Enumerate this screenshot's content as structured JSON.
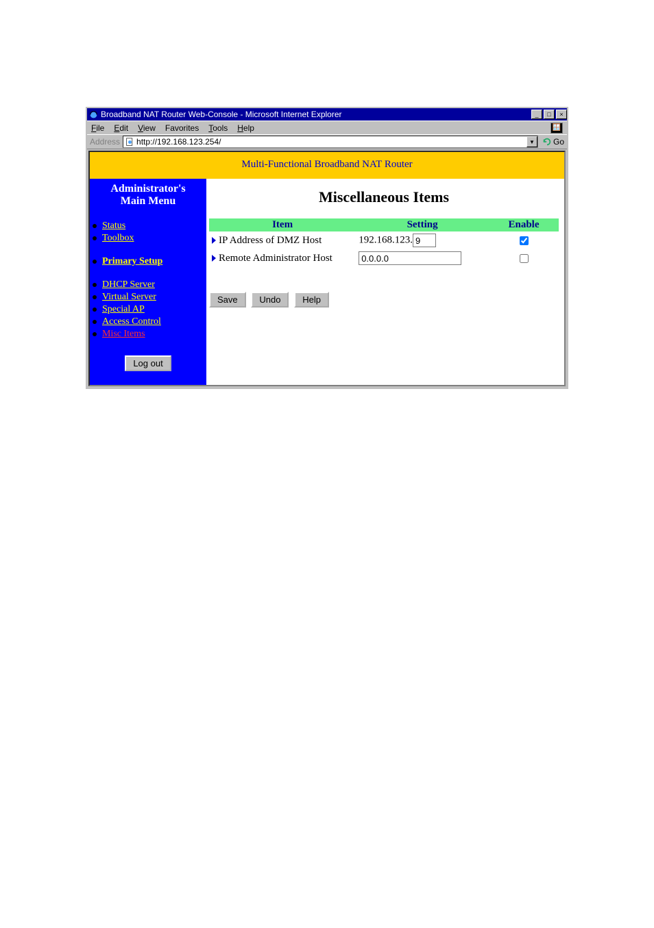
{
  "window": {
    "title": "Broadband NAT Router Web-Console - Microsoft Internet Explorer",
    "minimize": "_",
    "maximize": "□",
    "close": "×"
  },
  "menu": {
    "file": "File",
    "edit": "Edit",
    "view": "View",
    "favorites": "Favorites",
    "tools": "Tools",
    "help": "Help"
  },
  "address": {
    "label": "Address",
    "url": "http://192.168.123.254/",
    "go": "Go"
  },
  "banner": "Multi-Functional Broadband NAT Router",
  "sidebar": {
    "title1": "Administrator's",
    "title2": "Main Menu",
    "group1": [
      {
        "label": "Status"
      },
      {
        "label": "Toolbox"
      }
    ],
    "group2": [
      {
        "label": "Primary Setup"
      }
    ],
    "group3": [
      {
        "label": "DHCP Server"
      },
      {
        "label": "Virtual Server"
      },
      {
        "label": "Special AP"
      },
      {
        "label": "Access Control"
      },
      {
        "label": "Misc Items",
        "active": true
      }
    ],
    "logout": "Log out"
  },
  "content": {
    "title": "Miscellaneous Items",
    "header": {
      "item": "Item",
      "setting": "Setting",
      "enable": "Enable"
    },
    "rows": {
      "dmz": {
        "label": "IP Address of DMZ Host",
        "prefix": "192.168.123.",
        "value": "9",
        "enabled": true
      },
      "remote": {
        "label": "Remote Administrator Host",
        "value": "0.0.0.0",
        "enabled": false
      }
    },
    "buttons": {
      "save": "Save",
      "undo": "Undo",
      "help": "Help"
    }
  }
}
